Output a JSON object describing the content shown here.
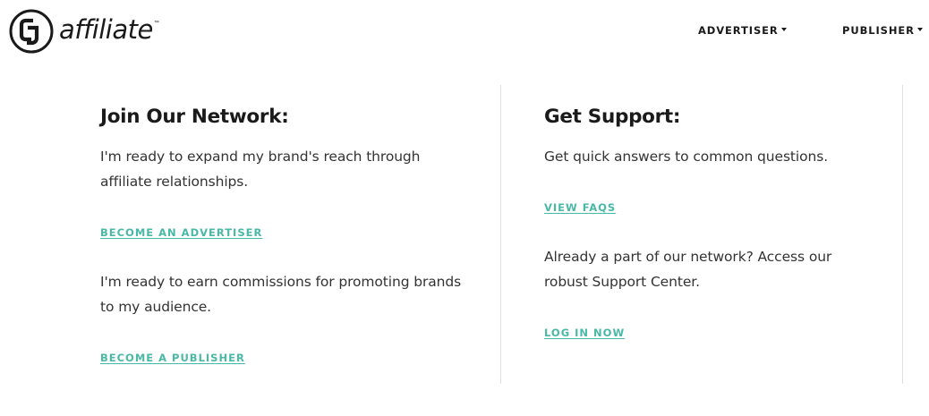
{
  "header": {
    "logo_mark": "CJ",
    "logo_text": "affiliate",
    "logo_tm": "™",
    "nav": [
      {
        "label": "ADVERTISER"
      },
      {
        "label": "PUBLISHER"
      }
    ]
  },
  "join": {
    "title": "Join Our Network:",
    "advertiser_text": "I'm ready to expand my brand's reach through affiliate relationships.",
    "advertiser_cta": "BECOME AN ADVERTISER",
    "publisher_text": "I'm ready to earn commissions for promoting brands to my audience.",
    "publisher_cta": "BECOME A PUBLISHER"
  },
  "support": {
    "title": "Get Support:",
    "faq_text": "Get quick answers to common questions.",
    "faq_cta": "VIEW FAQS",
    "login_text": "Already a part of our network? Access our robust Support Center.",
    "login_cta": "LOG IN NOW"
  },
  "colors": {
    "accent": "#49b8a6",
    "text": "#333333",
    "heading": "#1a1a1a",
    "divider": "#dedede"
  }
}
